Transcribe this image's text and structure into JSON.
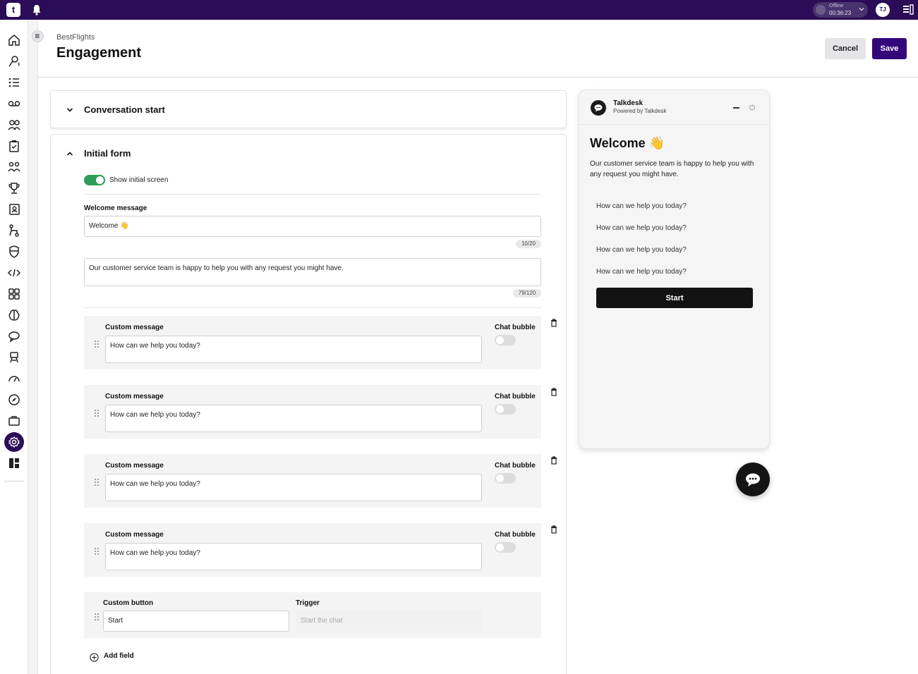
{
  "topbar": {
    "logo_text": "t",
    "status_label": "Offline",
    "status_time": "00:36:23",
    "avatar_initials": "TJ"
  },
  "leftnav": {
    "items": [
      "home-icon",
      "voice-icon",
      "list-icon",
      "voicemail-icon",
      "users-icon",
      "clipboard-icon",
      "team-icon",
      "trophy-icon",
      "contacts-icon",
      "flow-icon",
      "shield-icon",
      "code-icon",
      "apps-icon",
      "brain-icon",
      "chat-icon",
      "robot-icon",
      "gauge-icon",
      "compass-icon",
      "briefcase-icon",
      "settings-icon",
      "layout-icon"
    ],
    "active": "settings-icon"
  },
  "header": {
    "breadcrumb": "BestFlights",
    "title": "Engagement",
    "cancel_label": "Cancel",
    "save_label": "Save"
  },
  "sections": {
    "conversation_start": {
      "title": "Conversation start",
      "expanded": false
    },
    "initial_form": {
      "title": "Initial form",
      "expanded": true,
      "show_initial_screen_label": "Show initial screen",
      "show_initial_screen_on": true,
      "welcome_label": "Welcome message",
      "welcome_value": "Welcome 👋",
      "welcome_counter": "10/20",
      "body_value": "Our customer service team is happy to help you with any request you might have.",
      "body_counter": "79/120",
      "custom_messages": [
        {
          "label": "Custom message",
          "value": "How can we help you today?",
          "bubble_label": "Chat bubble",
          "bubble_on": false
        },
        {
          "label": "Custom message",
          "value": "How can we help you today?",
          "bubble_label": "Chat bubble",
          "bubble_on": false
        },
        {
          "label": "Custom message",
          "value": "How can we help you today?",
          "bubble_label": "Chat bubble",
          "bubble_on": false
        },
        {
          "label": "Custom message",
          "value": "How can we help you today?",
          "bubble_label": "Chat bubble",
          "bubble_on": false
        }
      ],
      "custom_button": {
        "label": "Custom button",
        "value": "Start",
        "trigger_label": "Trigger",
        "trigger_placeholder": "Start the chat"
      },
      "add_field_label": "Add field"
    }
  },
  "preview": {
    "brand": "Talkdesk",
    "powered_by": "Powered by Talkdesk",
    "welcome": "Welcome 👋",
    "body": "Our customer service team is happy to help you with any request you might have.",
    "questions": [
      "How can we help you today?",
      "How can we help you today?",
      "How can we help you today?",
      "How can we help you today?"
    ],
    "start_label": "Start"
  },
  "colors": {
    "brand": "#2b0c56",
    "save": "#33067a",
    "toggle_on": "#2f9c5a"
  }
}
